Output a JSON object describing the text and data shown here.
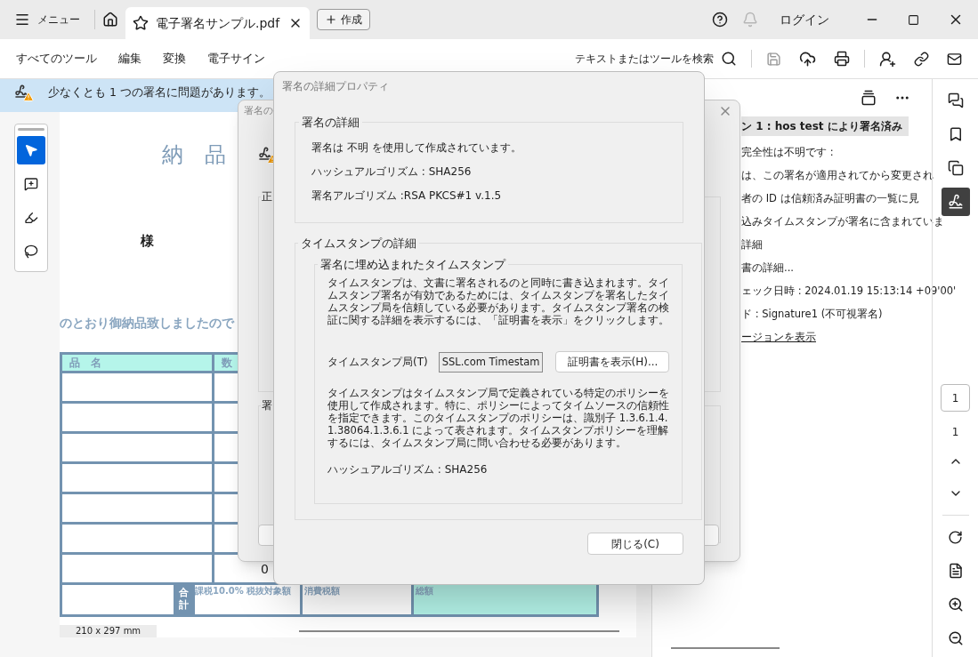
{
  "titlebar": {
    "menu_label": "メニュー",
    "tab_title": "電子署名サンプル.pdf",
    "create_label": "作成",
    "login_label": "ログイン"
  },
  "toolbar": {
    "items": [
      "すべてのツール",
      "編集",
      "変換",
      "電子サイン"
    ],
    "search_label": "テキストまたはツールを検索"
  },
  "notification": "少なくとも 1 つの署名に問題があります。",
  "tools": [
    {
      "kind": "select",
      "selected": true
    },
    {
      "kind": "comment",
      "selected": false
    },
    {
      "kind": "draw",
      "selected": false
    },
    {
      "kind": "lasso",
      "selected": false
    }
  ],
  "document": {
    "title": "納　品",
    "addressee": "様",
    "intro": "のとおり御納品致しましたので",
    "table_headers": [
      "品　名",
      "数"
    ],
    "cell_value": "0",
    "total_label": "合計",
    "total_headers": [
      "課税10.0% 税抜対象額",
      "消費税額",
      "総額"
    ]
  },
  "page_size": "210 x 297 mm",
  "signature_panel": {
    "heading": "ン 1 : hos test により署名済み",
    "lines": [
      "完全性は不明です :",
      "は、この署名が適用されてから変更され",
      "者の ID は信頼済み証明書の一覧に見",
      "込みタイムスタンプが署名に含まれていま",
      "詳細",
      "書の詳細...",
      "ェック日時 : 2024.01.19 15:13:14 +09'00'",
      "ド : Signature1 (不可視署名)"
    ],
    "link": "ージョンを表示"
  },
  "rail": {
    "tools": [
      {
        "kind": "comments",
        "selected": false
      },
      {
        "kind": "bookmarks",
        "selected": false
      },
      {
        "kind": "pages",
        "selected": false
      },
      {
        "kind": "signatures",
        "selected": true
      }
    ],
    "page_number": "1",
    "page_count": "1"
  },
  "back_dialog": {
    "title": "署名の",
    "group_labels": [
      "正",
      "署"
    ]
  },
  "dialog": {
    "title": "署名の詳細プロパティ",
    "signature_group": {
      "label": "署名の詳細",
      "lines": [
        "署名は 不明 を使用して作成されています。",
        "ハッシュアルゴリズム : SHA256",
        "署名アルゴリズム :RSA PKCS#1 v.1.5"
      ]
    },
    "timestamp_group": {
      "label": "タイムスタンプの詳細",
      "inner_label": "署名に埋め込まれたタイムスタンプ",
      "intro": "タイムスタンプは、文書に署名されるのと同時に書き込まれます。タイムスタンプ署名が有効であるためには、タイムスタンプを署名したタイムスタンプ局を信頼している必要があります。タイムスタンプ署名の検証に関する詳細を表示するには、「証明書を表示」をクリックします。",
      "authority_label": "タイムスタンプ局(T)",
      "authority_value": "SSL.com Timestam",
      "certificate_button": "証明書を表示(H)...",
      "policy": "タイムスタンプはタイムスタンプ局で定義されている特定のポリシーを使用して作成されます。特に、ポリシーによってタイムソースの信頼性を指定できます。このタイムスタンプのポリシーは、識別子 1.3.6.1.4.1.38064.1.3.6.1 によって表されます。タイムスタンプポリシーを理解するには、タイムスタンプ局に問い合わせる必要があります。",
      "hash": "ハッシュアルゴリズム : SHA256"
    },
    "close_button": "閉じる(C)"
  }
}
